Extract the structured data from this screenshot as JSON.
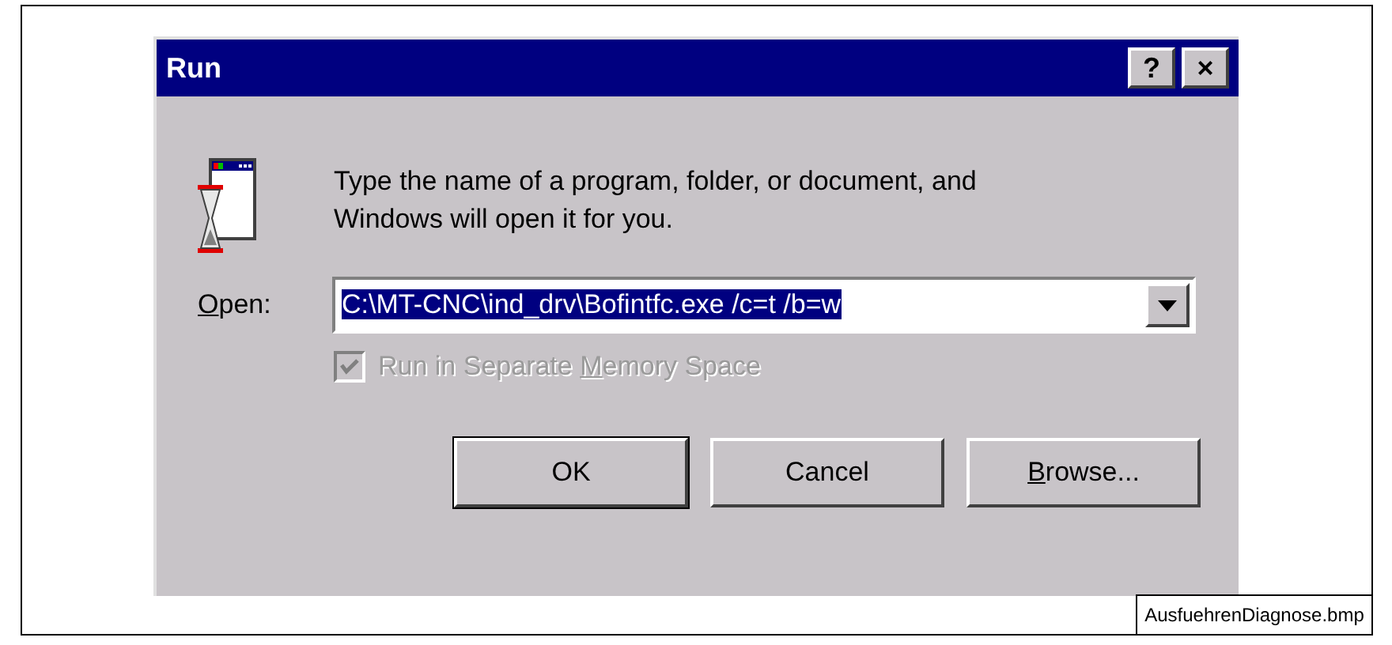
{
  "window": {
    "title": "Run",
    "title_buttons": [
      "?",
      "×"
    ]
  },
  "message": "Type the name of a program, folder, or document, and Windows will open it for you.",
  "open_field": {
    "label": {
      "key": "O",
      "after": "pen:"
    },
    "value": "C:\\MT-CNC\\ind_drv\\Bofintfc.exe /c=t /b=w",
    "selected": true
  },
  "checkbox": {
    "label": {
      "before": "Run in Separate ",
      "key": "M",
      "after": "emory Space"
    },
    "checked": true,
    "disabled": true
  },
  "buttons": [
    {
      "label": {
        "after": "OK"
      },
      "default": true
    },
    {
      "label": {
        "after": "Cancel"
      },
      "default": false
    },
    {
      "label": {
        "key": "B",
        "after": "rowse..."
      },
      "default": false
    }
  ],
  "caption": "AusfuehrenDiagnose.bmp"
}
